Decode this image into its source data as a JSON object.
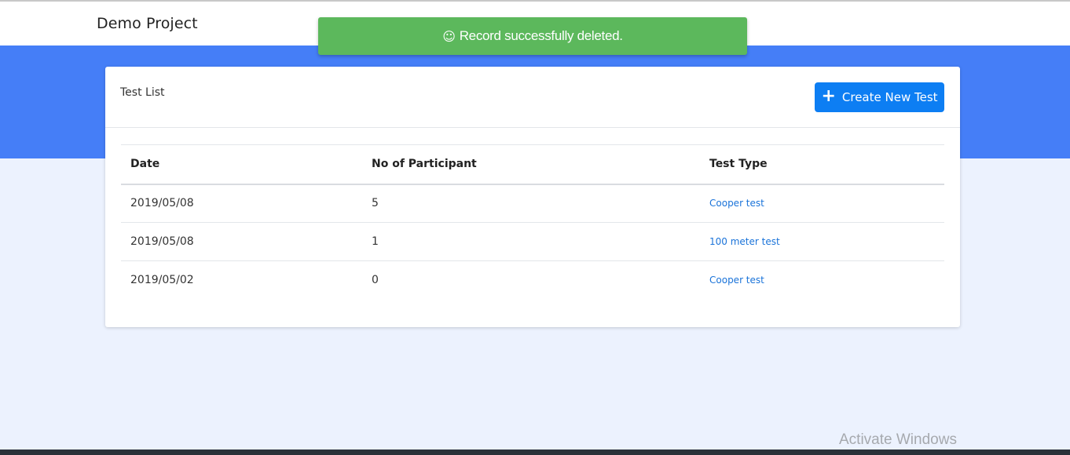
{
  "navbar": {
    "brand": "Demo Project"
  },
  "toast": {
    "icon": "smile-icon",
    "message": "Record successfully deleted."
  },
  "card": {
    "title": "Test List",
    "create_button_label": "Create New Test"
  },
  "table": {
    "headers": [
      "Date",
      "No of Participant",
      "Test Type"
    ],
    "rows": [
      {
        "date": "2019/05/08",
        "participants": "5",
        "test_type": "Cooper test"
      },
      {
        "date": "2019/05/08",
        "participants": "1",
        "test_type": "100 meter test"
      },
      {
        "date": "2019/05/02",
        "participants": "0",
        "test_type": "Cooper test"
      }
    ]
  },
  "watermark": "Activate Windows",
  "colors": {
    "hero": "#457ef7",
    "toast": "#5cb85c",
    "primary_button": "#0d7ef3",
    "link": "#1a73d9",
    "page_bg": "#ecf2fe"
  }
}
